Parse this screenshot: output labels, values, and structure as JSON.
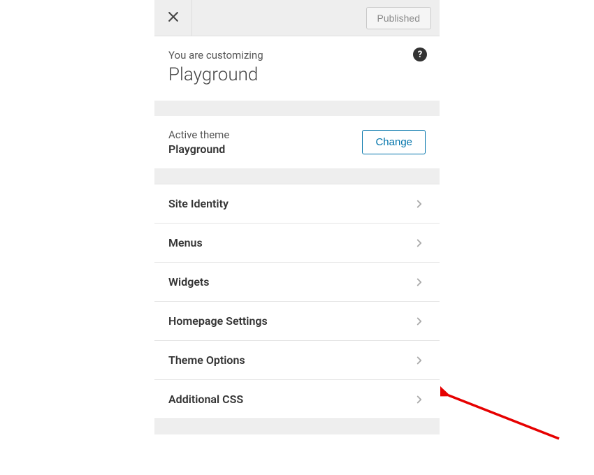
{
  "topBar": {
    "publishedLabel": "Published"
  },
  "customizing": {
    "label": "You are customizing",
    "title": "Playground",
    "helpGlyph": "?"
  },
  "theme": {
    "label": "Active theme",
    "name": "Playground",
    "changeLabel": "Change"
  },
  "menu": {
    "items": [
      {
        "label": "Site Identity"
      },
      {
        "label": "Menus"
      },
      {
        "label": "Widgets"
      },
      {
        "label": "Homepage Settings"
      },
      {
        "label": "Theme Options"
      },
      {
        "label": "Additional CSS"
      }
    ]
  }
}
